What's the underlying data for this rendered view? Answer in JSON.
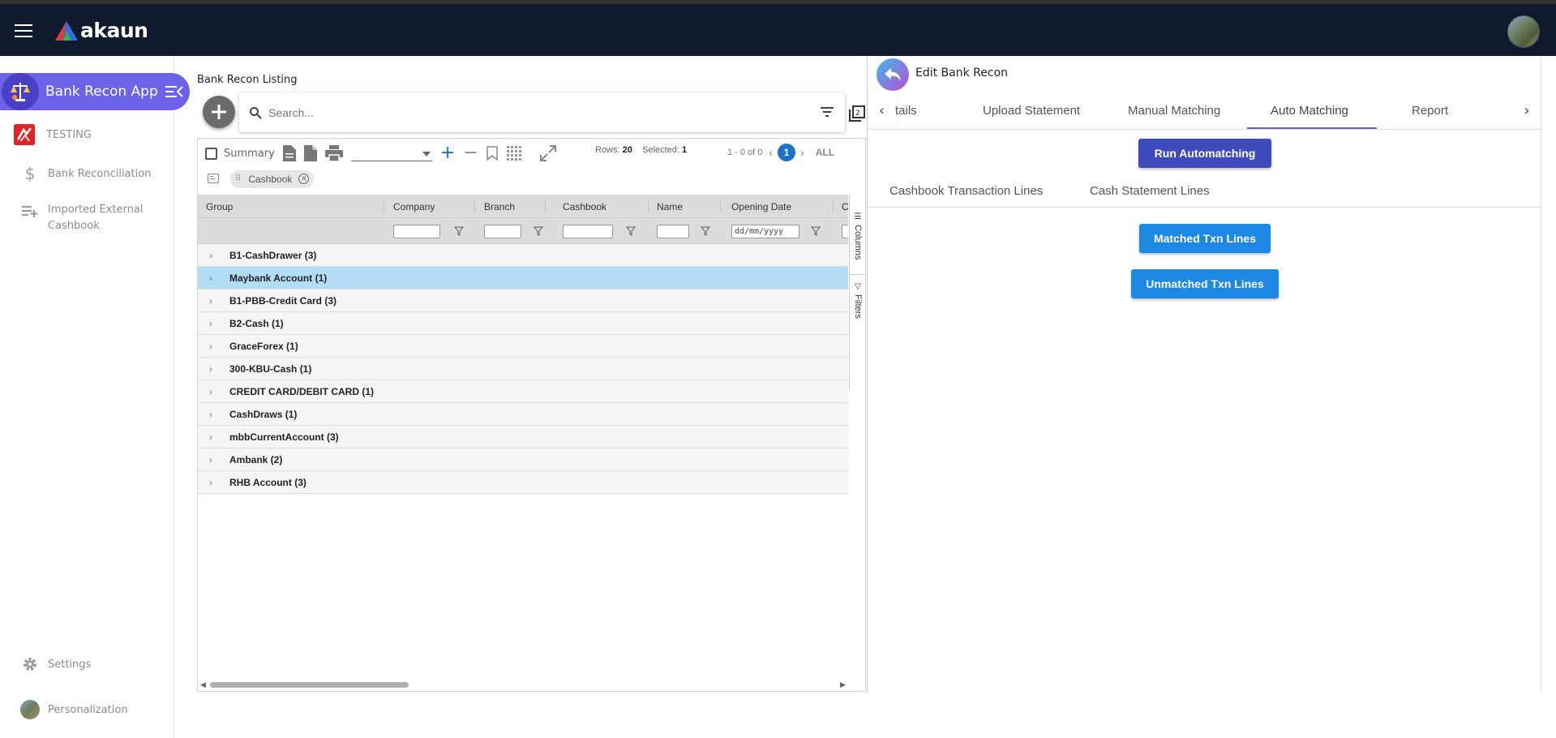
{
  "topbar": {
    "brand": "akaun"
  },
  "sidebar": {
    "app_name": "Bank Recon Applet",
    "items": [
      {
        "label": "TESTING"
      },
      {
        "label": "Bank Reconciliation"
      },
      {
        "label": "Imported External Cashbook"
      },
      {
        "label": "Settings"
      },
      {
        "label": "Personalization"
      }
    ]
  },
  "listing": {
    "title": "Bank Recon Listing",
    "search_placeholder": "Search...",
    "toolbar": {
      "summary_label": "Summary",
      "rows_label": "Rows:",
      "rows_value": "20",
      "selected_label": "Selected:",
      "selected_value": "1",
      "range": "1 - 0 of 0",
      "page": "1",
      "all_label": "ALL"
    },
    "group_chip": "Cashbook",
    "columns": [
      "Group",
      "Company",
      "Branch",
      "Cashbook",
      "Name",
      "Opening Date",
      "C"
    ],
    "date_placeholder": "dd/mm/yyyy",
    "side_tabs": [
      "Columns",
      "Filters"
    ],
    "rows": [
      {
        "label": "B1-CashDrawer (3)",
        "selected": false
      },
      {
        "label": "Maybank Account (1)",
        "selected": true
      },
      {
        "label": "B1-PBB-Credit Card (3)",
        "selected": false
      },
      {
        "label": "B2-Cash (1)",
        "selected": false
      },
      {
        "label": "GraceForex (1)",
        "selected": false
      },
      {
        "label": "300-KBU-Cash (1)",
        "selected": false
      },
      {
        "label": "CREDIT CARD/DEBIT CARD (1)",
        "selected": false
      },
      {
        "label": "CashDraws (1)",
        "selected": false
      },
      {
        "label": "mbbCurrentAccount (3)",
        "selected": false
      },
      {
        "label": "Ambank (2)",
        "selected": false
      },
      {
        "label": "RHB Account (3)",
        "selected": false
      }
    ]
  },
  "editor": {
    "title": "Edit Bank Recon",
    "tabs": [
      "tails",
      "Upload Statement",
      "Manual Matching",
      "Auto Matching",
      "Report"
    ],
    "active_tab": "Auto Matching",
    "run_button": "Run Automatching",
    "subtabs": [
      "Cashbook Transaction Lines",
      "Cash Statement Lines"
    ],
    "matched_button": "Matched Txn Lines",
    "unmatched_button": "Unmatched Txn Lines"
  },
  "colors": {
    "topbar": "#0f1a2e",
    "app_pill": "#6c63e9",
    "selected_row": "#b3dcf7",
    "run_button": "#3f4bbd",
    "action_button": "#1e88e5",
    "tab_indicator": "#6b5bd6"
  }
}
